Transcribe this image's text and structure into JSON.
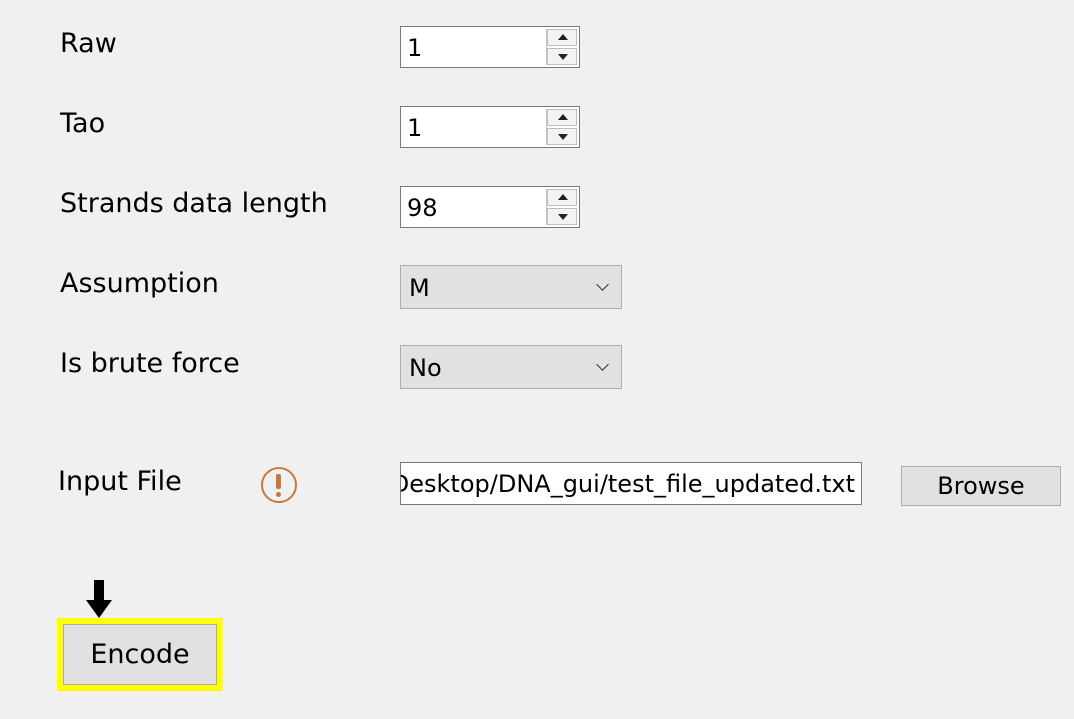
{
  "fields": {
    "raw": {
      "label": "Raw",
      "value": "1"
    },
    "tao": {
      "label": "Tao",
      "value": "1"
    },
    "strands": {
      "label": "Strands data length",
      "value": "98"
    },
    "assumption": {
      "label": "Assumption",
      "value": "M"
    },
    "brute_force": {
      "label": "Is brute force",
      "value": "No"
    }
  },
  "input_file": {
    "label": "Input File",
    "value": "'Desktop/DNA_gui/test_file_updated.txt",
    "browse_label": "Browse",
    "warning_icon": "exclamation-circle-icon"
  },
  "actions": {
    "encode_label": "Encode",
    "highlight_color": "#ffff00",
    "pointer_icon": "down-arrow-icon"
  }
}
